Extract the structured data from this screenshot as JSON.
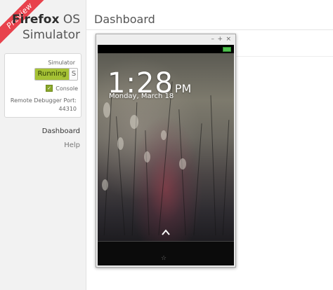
{
  "ribbon": {
    "label": "Preview"
  },
  "brand": {
    "name_bold": "Firefox",
    "name_light": "OS",
    "line2": "Simulator"
  },
  "simulator_panel": {
    "label": "Simulator",
    "toggle_on_label": "Running",
    "toggle_off_label": "S",
    "console_label": "Console",
    "console_checked": true,
    "port_label": "Remote Debugger Port:",
    "port_value": "44310"
  },
  "nav": {
    "items": [
      "Dashboard",
      "Help"
    ],
    "active": "Dashboard"
  },
  "page": {
    "title": "Dashboard"
  },
  "sim_window": {
    "buttons": {
      "minimize": "–",
      "maximize": "+",
      "close": "×"
    },
    "lockscreen": {
      "time": "1:28",
      "ampm": "PM",
      "date": "Monday, March 18"
    },
    "home_icon": "star-icon"
  },
  "colors": {
    "ribbon": "#e8424c",
    "running": "#a6c235",
    "checkbox": "#8aa72a",
    "battery": "#4ec04e"
  }
}
